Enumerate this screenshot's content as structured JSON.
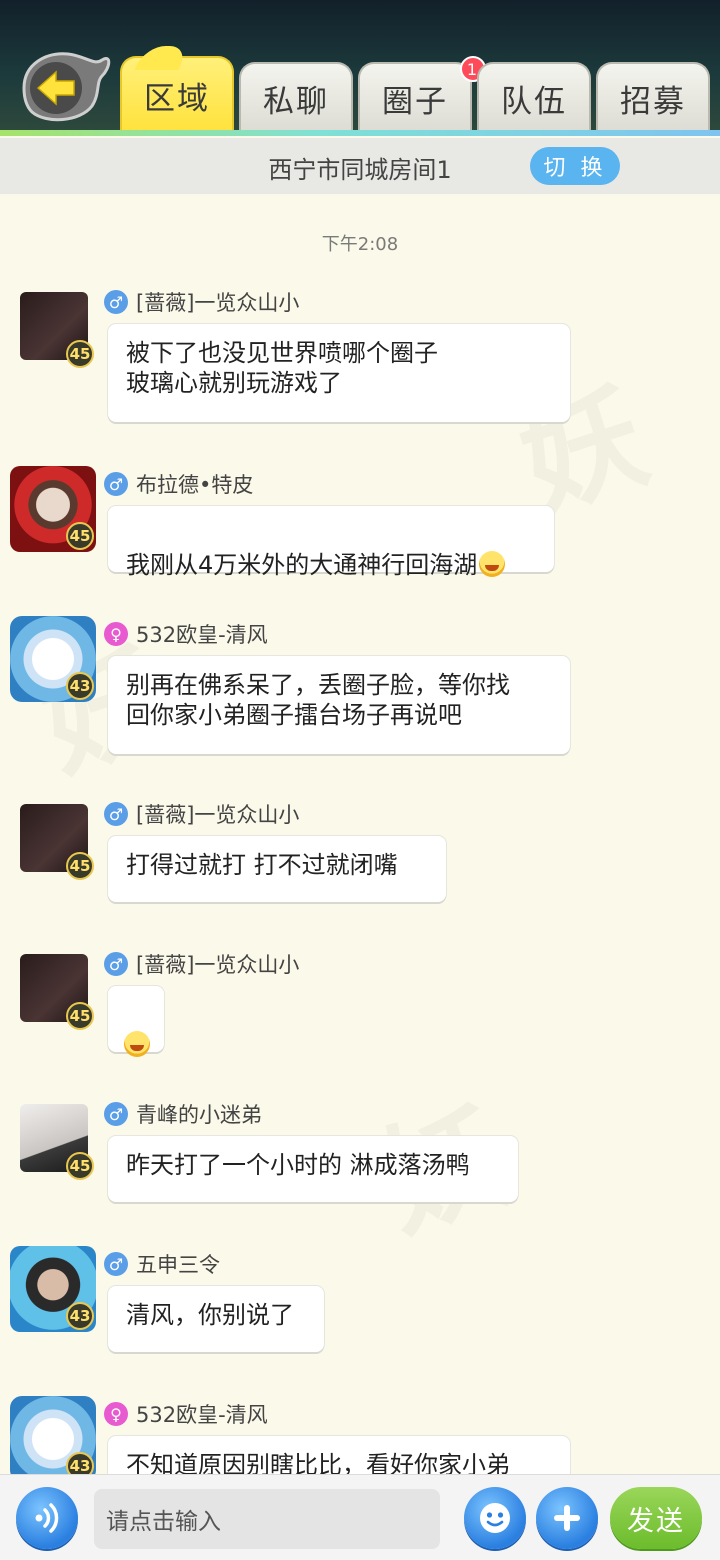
{
  "header": {
    "tabs": [
      {
        "label": "区域",
        "active": true
      },
      {
        "label": "私聊"
      },
      {
        "label": "圈子",
        "badge": "1"
      },
      {
        "label": "队伍"
      },
      {
        "label": "招募"
      }
    ]
  },
  "room": {
    "title": "西宁市同城房间1",
    "switch_label": "切 换"
  },
  "chat": {
    "timestamp": "下午2:08",
    "messages": [
      {
        "name": "[蔷薇]一览众山小",
        "gender": "male",
        "level": "45",
        "text": "被下了也没见世界喷哪个圈子\n玻璃心就别玩游戏了"
      },
      {
        "name": "布拉德•特皮",
        "gender": "male",
        "level": "45",
        "text": "我刚从4万米外的大通神行回海湖"
      },
      {
        "name": "532欧皇-清风",
        "gender": "female",
        "level": "43",
        "text": "别再在佛系呆了，丢圈子脸，等你找\n回你家小弟圈子擂台场子再说吧"
      },
      {
        "name": "[蔷薇]一览众山小",
        "gender": "male",
        "level": "45",
        "text": "打得过就打 打不过就闭嘴"
      },
      {
        "name": "[蔷薇]一览众山小",
        "gender": "male",
        "level": "45",
        "text": ""
      },
      {
        "name": "青峰的小迷弟",
        "gender": "male",
        "level": "45",
        "text": "昨天打了一个小时的 淋成落汤鸭"
      },
      {
        "name": "五申三令",
        "gender": "male",
        "level": "43",
        "text": "清风，你别说了"
      },
      {
        "name": "532欧皇-清风",
        "gender": "female",
        "level": "43",
        "text": "不知道原因别瞎比比，看好你家小弟"
      }
    ]
  },
  "composer": {
    "placeholder": "请点击输入",
    "send_label": "发送"
  },
  "icons": {
    "back": "back-arrow-icon",
    "voice": "voice-icon",
    "emoji": "emoji-icon",
    "plus": "plus-icon",
    "male": "male-icon",
    "female": "female-icon"
  },
  "colors": {
    "active_tab": "#ffe23c",
    "switch_button": "#5ab4ef",
    "send_button": "#6cbc2c",
    "badge": "#ff4a5a"
  }
}
